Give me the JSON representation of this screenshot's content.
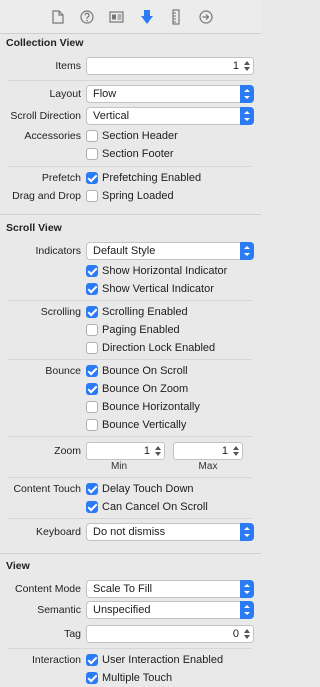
{
  "toolbar": {
    "icons": [
      "file-icon",
      "help-icon",
      "identity-icon",
      "attributes-icon",
      "size-ruler-icon",
      "connections-icon"
    ],
    "active": "attributes-icon",
    "accent": "#2c7bf6"
  },
  "collection_view": {
    "title": "Collection View",
    "items_label": "Items",
    "items_value": "1",
    "layout_label": "Layout",
    "layout_value": "Flow",
    "scroll_direction_label": "Scroll Direction",
    "scroll_direction_value": "Vertical",
    "accessories_label": "Accessories",
    "section_header": {
      "label": "Section Header",
      "checked": false
    },
    "section_footer": {
      "label": "Section Footer",
      "checked": false
    },
    "prefetch_label": "Prefetch",
    "prefetching_enabled": {
      "label": "Prefetching Enabled",
      "checked": true
    },
    "drag_drop_label": "Drag and Drop",
    "spring_loaded": {
      "label": "Spring Loaded",
      "checked": false
    }
  },
  "scroll_view": {
    "title": "Scroll View",
    "indicators_label": "Indicators",
    "indicators_value": "Default Style",
    "show_horizontal": {
      "label": "Show Horizontal Indicator",
      "checked": true
    },
    "show_vertical": {
      "label": "Show Vertical Indicator",
      "checked": true
    },
    "scrolling_label": "Scrolling",
    "scrolling_enabled": {
      "label": "Scrolling Enabled",
      "checked": true
    },
    "paging_enabled": {
      "label": "Paging Enabled",
      "checked": false
    },
    "direction_lock": {
      "label": "Direction Lock Enabled",
      "checked": false
    },
    "bounce_label": "Bounce",
    "bounce_on_scroll": {
      "label": "Bounce On Scroll",
      "checked": true
    },
    "bounce_on_zoom": {
      "label": "Bounce On Zoom",
      "checked": true
    },
    "bounce_horizontally": {
      "label": "Bounce Horizontally",
      "checked": false
    },
    "bounce_vertically": {
      "label": "Bounce Vertically",
      "checked": false
    },
    "zoom_label": "Zoom",
    "zoom_min_value": "1",
    "zoom_max_value": "1",
    "min_label": "Min",
    "max_label": "Max",
    "content_touch_label": "Content Touch",
    "delay_touch_down": {
      "label": "Delay Touch Down",
      "checked": true
    },
    "can_cancel_on_scroll": {
      "label": "Can Cancel On Scroll",
      "checked": true
    },
    "keyboard_label": "Keyboard",
    "keyboard_value": "Do not dismiss"
  },
  "view": {
    "title": "View",
    "content_mode_label": "Content Mode",
    "content_mode_value": "Scale To Fill",
    "semantic_label": "Semantic",
    "semantic_value": "Unspecified",
    "tag_label": "Tag",
    "tag_value": "0",
    "interaction_label": "Interaction",
    "user_interaction_enabled": {
      "label": "User Interaction Enabled",
      "checked": true
    },
    "multiple_touch": {
      "label": "Multiple Touch",
      "checked": true
    }
  }
}
